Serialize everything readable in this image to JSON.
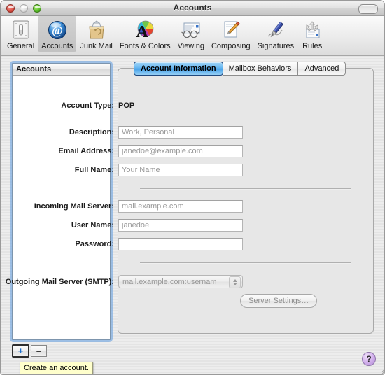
{
  "window": {
    "title": "Accounts",
    "traffic_lights": [
      "close",
      "minimize",
      "zoom"
    ],
    "toolbar_toggle": "toolbar-toggle-pill"
  },
  "toolbar": {
    "items": [
      {
        "label": "General",
        "icon": "general-switch-icon",
        "selected": false
      },
      {
        "label": "Accounts",
        "icon": "at-sign-globe-icon",
        "selected": true
      },
      {
        "label": "Junk Mail",
        "icon": "junk-mail-bag-icon",
        "selected": false
      },
      {
        "label": "Fonts & Colors",
        "icon": "color-wheel-a-icon",
        "selected": false
      },
      {
        "label": "Viewing",
        "icon": "eyeglasses-mail-icon",
        "selected": false
      },
      {
        "label": "Composing",
        "icon": "pencil-paper-icon",
        "selected": false
      },
      {
        "label": "Signatures",
        "icon": "fountain-pen-icon",
        "selected": false
      },
      {
        "label": "Rules",
        "icon": "rules-arrows-icon",
        "selected": false
      }
    ]
  },
  "accounts_list": {
    "header": "Accounts",
    "rows": [],
    "add_button": "+",
    "remove_button": "–",
    "tooltip": "Create an account."
  },
  "tabs": [
    {
      "label": "Account Information",
      "active": true
    },
    {
      "label": "Mailbox Behaviors",
      "active": false
    },
    {
      "label": "Advanced",
      "active": false
    }
  ],
  "form": {
    "account_type": {
      "label": "Account Type:",
      "value": "POP"
    },
    "fields": [
      {
        "label": "Description:",
        "placeholder": "Work, Personal",
        "value": "",
        "type": "text"
      },
      {
        "label": "Email Address:",
        "placeholder": "janedoe@example.com",
        "value": "",
        "type": "text"
      },
      {
        "label": "Full Name:",
        "placeholder": "Your Name",
        "value": "",
        "type": "text"
      },
      {
        "label": "Incoming Mail Server:",
        "placeholder": "mail.example.com",
        "value": "",
        "type": "text"
      },
      {
        "label": "User Name:",
        "placeholder": "janedoe",
        "value": "",
        "type": "text"
      },
      {
        "label": "Password:",
        "placeholder": "",
        "value": "",
        "type": "password"
      }
    ],
    "smtp": {
      "label": "Outgoing Mail Server (SMTP):",
      "selected_option": "mail.example.com:usernam",
      "server_settings_button": "Server Settings…"
    }
  },
  "help": {
    "button_glyph": "?"
  },
  "colors": {
    "window_background": "#e8e8e8",
    "selected_tab_blue": "#4aa3e8",
    "focus_ring_blue": "#82afe1",
    "tooltip_yellow": "#ffffcc",
    "help_purple": "#d3b2ec",
    "placeholder_gray": "#9a9a9a",
    "close_red": "#e0564b",
    "zoom_green": "#5ec52c"
  }
}
